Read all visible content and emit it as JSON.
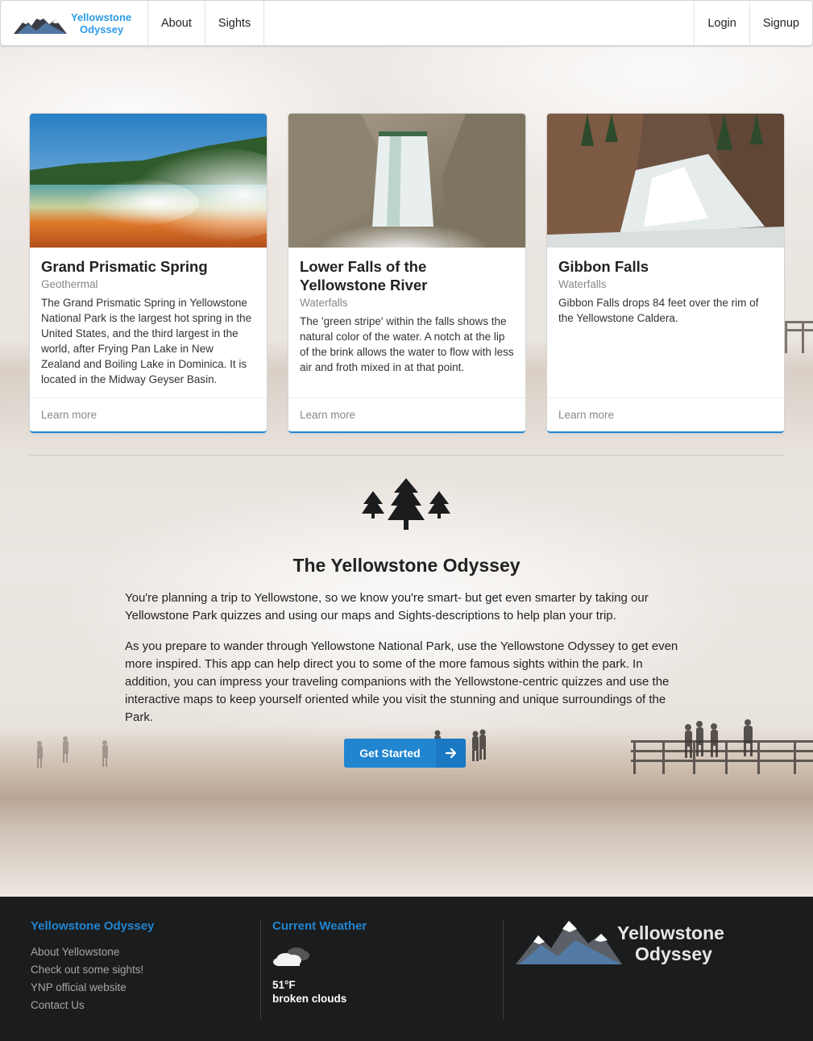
{
  "brand": {
    "logo_line1": "Yellowstone",
    "logo_line2": "Odyssey",
    "accent_color": "#2185d0"
  },
  "nav": {
    "items": [
      {
        "label": "About"
      },
      {
        "label": "Sights"
      }
    ],
    "right": [
      {
        "label": "Login"
      },
      {
        "label": "Signup"
      }
    ]
  },
  "cards": [
    {
      "title": "Grand Prismatic Spring",
      "meta": "Geothermal",
      "description": "The Grand Prismatic Spring in Yellowstone National Park is the largest hot spring in the United States, and the third largest in the world, after Frying Pan Lake in New Zealand and Boiling Lake in Dominica. It is located in the Midway Geyser Basin.",
      "link": "Learn more"
    },
    {
      "title": "Lower Falls of the Yellowstone River",
      "meta": "Waterfalls",
      "description": "The 'green stripe' within the falls shows the natural color of the water. A notch at the lip of the brink allows the water to flow with less air and froth mixed in at that point.",
      "link": "Learn more"
    },
    {
      "title": "Gibbon Falls",
      "meta": "Waterfalls",
      "description": "Gibbon Falls drops 84 feet over the rim of the Yellowstone Caldera.",
      "link": "Learn more"
    }
  ],
  "about": {
    "title": "The Yellowstone Odyssey",
    "p1": "You're planning a trip to Yellowstone, so we know you're smart- but get even smarter by taking our Yellowstone Park quizzes and using our maps and Sights-descriptions to help plan your trip.",
    "p2": "As you prepare to wander through Yellowstone National Park, use the Yellowstone Odyssey to get even more inspired. This app can help direct you to some of the more famous sights within the park. In addition, you can impress your traveling companions with the Yellowstone-centric quizzes and use the interactive maps to keep yourself oriented while you visit the stunning and unique surroundings of the Park.",
    "button": "Get Started"
  },
  "footer": {
    "col1": {
      "heading": "Yellowstone Odyssey",
      "links": [
        "About Yellowstone",
        "Check out some sights!",
        "YNP official website",
        "Contact Us"
      ]
    },
    "col2": {
      "heading": "Current Weather",
      "icon": "broken-clouds-icon",
      "temp": "51°F",
      "condition": "broken clouds"
    },
    "logo_line1": "Yellowstone",
    "logo_line2": "Odyssey"
  }
}
